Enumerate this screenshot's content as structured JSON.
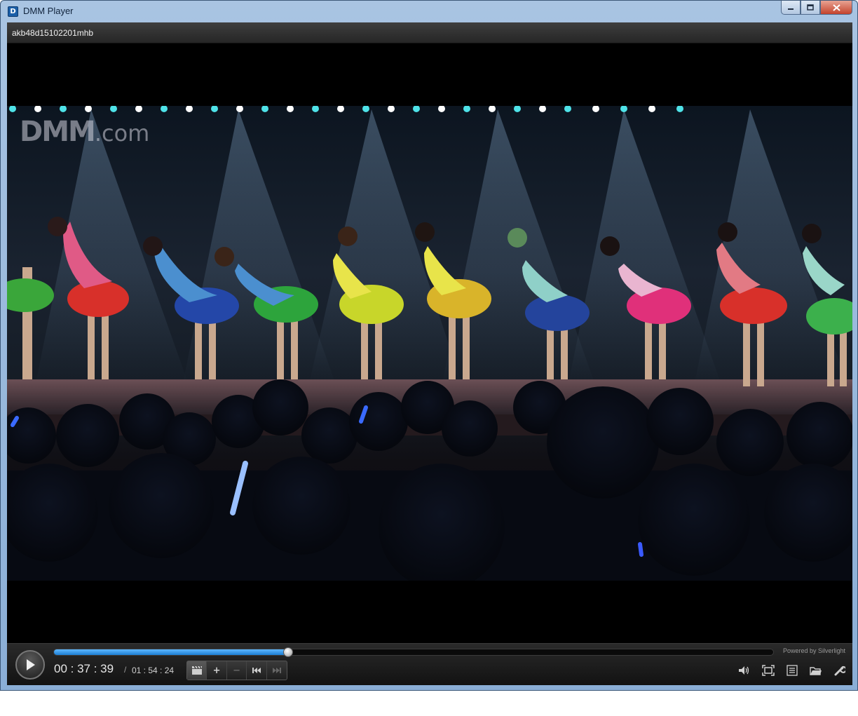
{
  "window": {
    "title": "DMM Player",
    "app_icon_glyph": "D"
  },
  "window_controls": {
    "minimize_icon": "minimize-icon",
    "maximize_icon": "maximize-icon",
    "close_icon": "close-icon"
  },
  "file": {
    "name": "akb48d15102201mhb"
  },
  "video": {
    "watermark_main": "DMM",
    "watermark_suffix": ".com",
    "description": "stage performance video frame"
  },
  "controls": {
    "powered_by": "Powered by Silverlight",
    "current_time": "00 : 37 : 39",
    "separator": "/",
    "total_time": "01 : 54 : 24",
    "progress_fraction": 0.326,
    "accent_color": "#2b8fe6",
    "buttons": {
      "play_icon": "play-icon",
      "chapter_icon": "clapperboard-icon",
      "add_label": "+",
      "remove_label": "−",
      "prev_icon": "skip-back-icon",
      "next_icon": "skip-forward-icon",
      "volume_icon": "volume-icon",
      "fullscreen_icon": "fullscreen-icon",
      "playlist_icon": "playlist-icon",
      "open_icon": "folder-icon",
      "settings_icon": "wrench-icon"
    }
  }
}
